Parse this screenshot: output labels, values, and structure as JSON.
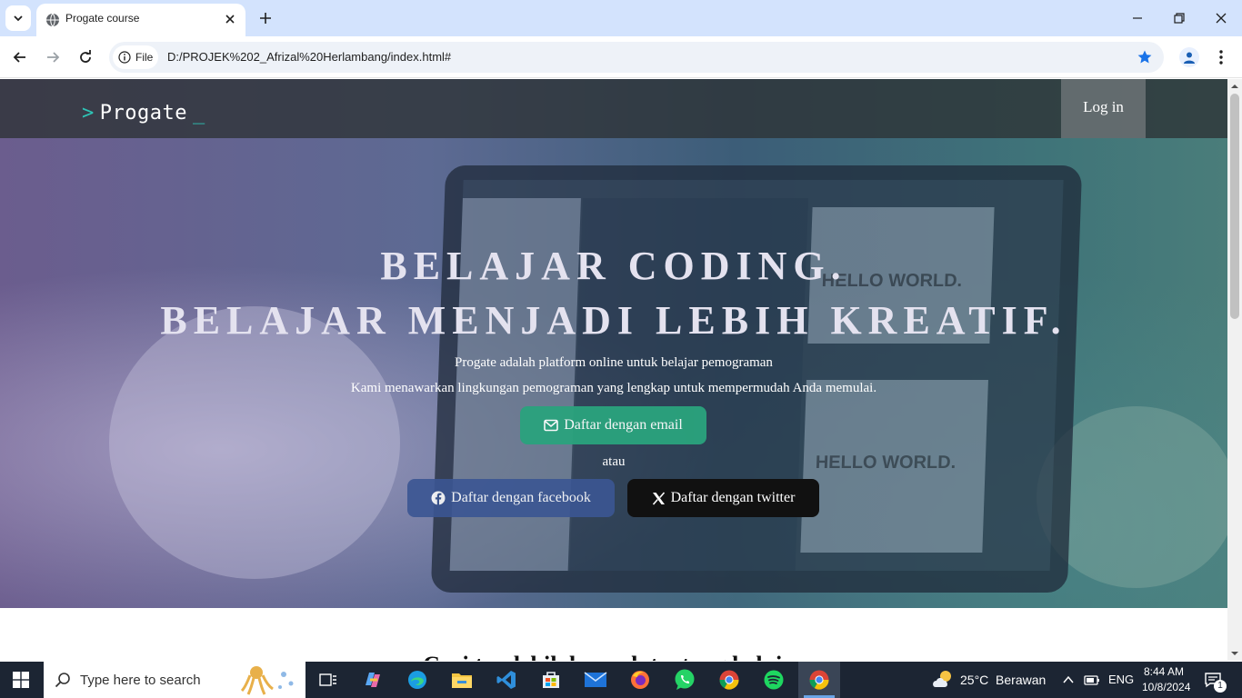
{
  "browser": {
    "tab_title": "Progate course",
    "chip_label": "File",
    "url": "D:/PROJEK%202_Afrizal%20Herlambang/index.html#"
  },
  "page": {
    "logo_text": "Progate",
    "login_label": "Log in",
    "headline_1": "BELAJAR CODING.",
    "headline_2": "BELAJAR MENJADI LEBIH KREATIF.",
    "lead_1": "Progate adalah platform online untuk belajar pemograman",
    "lead_2": "Kami menawarkan lingkungan pemograman yang lengkap untuk mempermudah Anda memulai.",
    "email_button": "Daftar dengan email",
    "or_text": "atau",
    "facebook_button": "Daftar dengan facebook",
    "twitter_button": "Daftar dengan twitter",
    "section_title": "Cari tau lebih banyak tentang belajar",
    "screen_text": "HELLO WORLD."
  },
  "taskbar": {
    "search_placeholder": "Type here to search",
    "weather": "25°C  Berawan",
    "language": "ENG",
    "time": "8:44 AM",
    "date": "10/8/2024",
    "notification_count": "1"
  },
  "colors": {
    "accent_green": "#2aa37d",
    "facebook_blue": "#3b5693",
    "logo_accent": "#2ec4b6"
  }
}
